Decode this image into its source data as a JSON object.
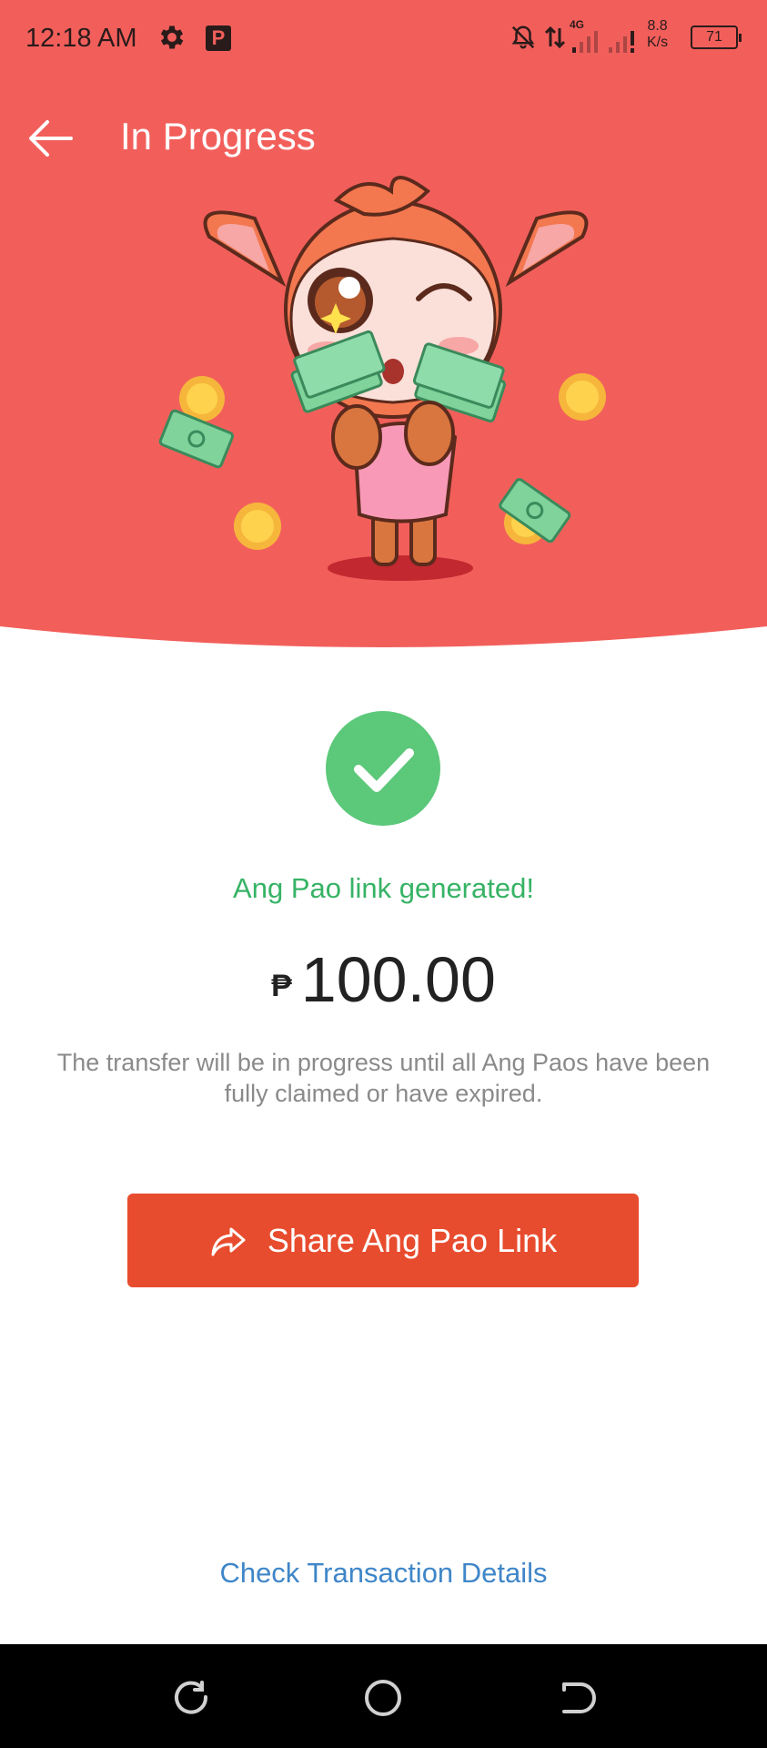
{
  "status_bar": {
    "time": "12:18 AM",
    "settings_icon": "gear-icon",
    "app_badge": "P",
    "network_type": "4G",
    "net_speed_value": "8.8",
    "net_speed_unit": "K/s",
    "battery_level": "71"
  },
  "toolbar": {
    "back_icon": "back-arrow-icon",
    "title": "In Progress"
  },
  "colors": {
    "header_bg": "#f25f5b",
    "success_green": "#5cc87a",
    "button_bg": "#e84c2e",
    "link_blue": "#3f86c8"
  },
  "main": {
    "status_icon": "checkmark-icon",
    "status_text": "Ang Pao link generated!",
    "currency_symbol": "₱",
    "amount": "100.00",
    "note": "The transfer will be in progress until all Ang Paos have been fully claimed or have expired.",
    "share_button_label": "Share Ang Pao Link",
    "share_icon": "share-arrow-icon",
    "details_link": "Check Transaction Details"
  },
  "nav_bar": {
    "items": [
      "recents-icon",
      "home-icon",
      "back-icon"
    ]
  }
}
